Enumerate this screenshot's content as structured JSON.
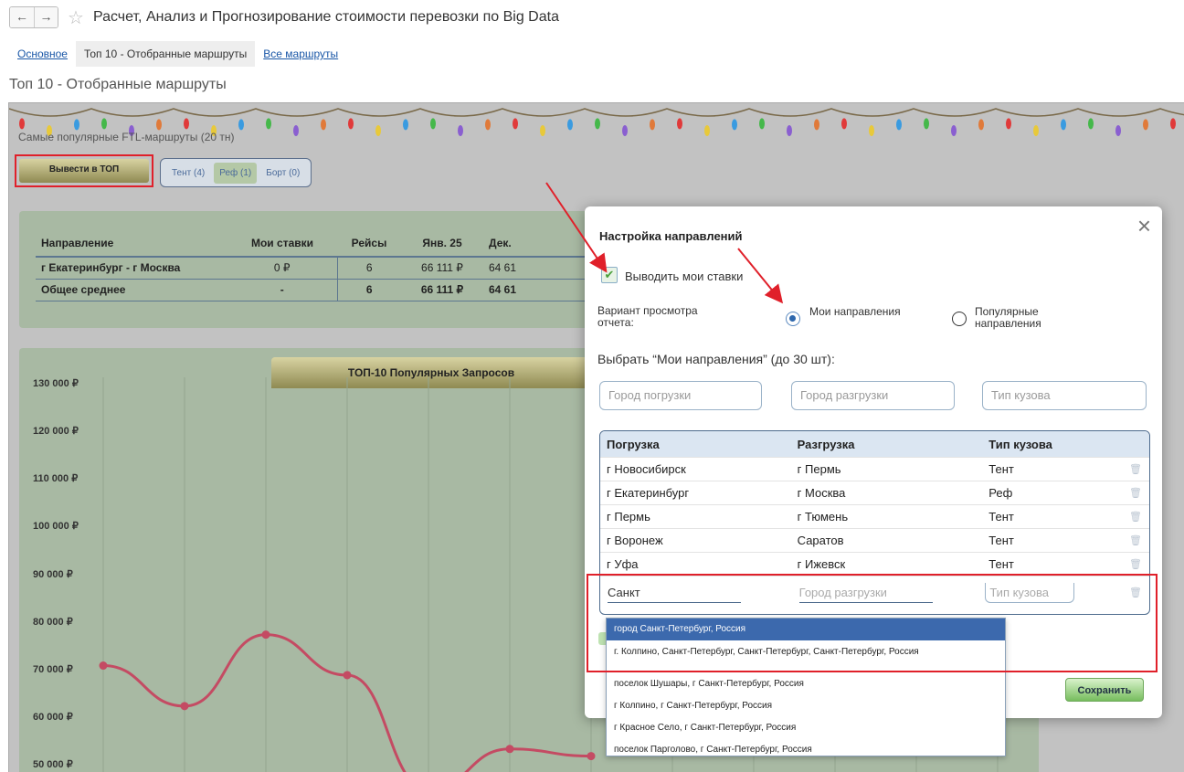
{
  "window": {
    "title": "Расчет, Анализ и Прогнозирование стоимости перевозки по Big Data",
    "back_icon": "arrow-left-icon",
    "forward_icon": "arrow-right-icon",
    "favorite_icon": "star-icon"
  },
  "tabs": [
    {
      "label": "Основное",
      "active": false
    },
    {
      "label": "Топ 10 - Отобранные маршруты",
      "active": true
    },
    {
      "label": "Все маршруты",
      "active": false
    }
  ],
  "page_title": "Топ 10 - Отобранные маршруты",
  "report": {
    "subtitle": "Самые популярные FTL-маршруты (20 тн)",
    "top_button": "Вывести в ТОП",
    "filters": [
      {
        "label": "Тент (4)",
        "active": false
      },
      {
        "label": "Реф (1)",
        "active": true
      },
      {
        "label": "Борт (0)",
        "active": false
      }
    ],
    "table": {
      "headers": [
        "Направление",
        "Мои ставки",
        "Рейсы",
        "Янв. 25",
        "Дек."
      ],
      "rows": [
        [
          "г Екатеринбург - г Москва",
          "0 ₽",
          "6",
          "66 111 ₽",
          "64 61"
        ],
        [
          "Общее среднее",
          "-",
          "6",
          "66 111 ₽",
          "64 61"
        ]
      ]
    },
    "chart_title": "ТОП-10 Популярных Запросов"
  },
  "chart_data": {
    "type": "line",
    "ylim": [
      50000,
      130000
    ],
    "y_ticks": [
      "130 000 ₽",
      "120 000 ₽",
      "110 000 ₽",
      "100 000 ₽",
      "90 000 ₽",
      "80 000 ₽",
      "70 000 ₽",
      "60 000 ₽",
      "50 000 ₽"
    ],
    "series": [
      {
        "values": [
          71000,
          62500,
          77500,
          69000,
          45000,
          53500,
          52000
        ]
      }
    ],
    "line_color": "#c44b63"
  },
  "modal": {
    "title": "Настройка направлений",
    "close_icon": "close-icon",
    "show_my_rates": {
      "label": "Выводить мои ставки",
      "checked": true
    },
    "view_variant": {
      "label": "Вариант просмотра отчета:",
      "options": [
        {
          "label": "Мои направления",
          "selected": true
        },
        {
          "label": "Популярные направления",
          "selected": false
        }
      ]
    },
    "choose_label": "Выбрать “Мои направления” (до 30 шт):",
    "inputs": {
      "load_city": "Город погрузки",
      "unload_city": "Город разгрузки",
      "body_type": "Тип кузова"
    },
    "grid": {
      "headers": [
        "Погрузка",
        "Разгрузка",
        "Тип кузова"
      ],
      "rows": [
        [
          "г Новосибирск",
          "г Пермь",
          "Тент"
        ],
        [
          "г Екатеринбург",
          "г Москва",
          "Реф"
        ],
        [
          "г Пермь",
          "г Тюмень",
          "Тент"
        ],
        [
          "г Воронеж",
          "Саратов",
          "Тент"
        ],
        [
          "г Уфа",
          "г Ижевск",
          "Тент"
        ]
      ],
      "delete_icon": "trash-icon",
      "edit_row": {
        "load_value": "Санкт",
        "unload_placeholder": "Город разгрузки",
        "body_placeholder": "Тип кузова"
      }
    },
    "suggestions": [
      "город Санкт-Петербург, Россия",
      "г. Колпино, Санкт-Петербург, Санкт-Петербург, Санкт-Петербург, Россия",
      "поселок Шушары, г Санкт-Петербург, Россия",
      "г Колпино, г Санкт-Петербург, Россия",
      "г Красное Село, г Санкт-Петербург, Россия",
      "поселок Парголово, г Санкт-Петербург, Россия"
    ],
    "save_button": "Сохранить"
  },
  "colors": {
    "highlight_border": "#e0202a",
    "arrow": "#e0202a",
    "accent_blue": "#3c69ad",
    "panel_green": "#a8b9a3"
  }
}
